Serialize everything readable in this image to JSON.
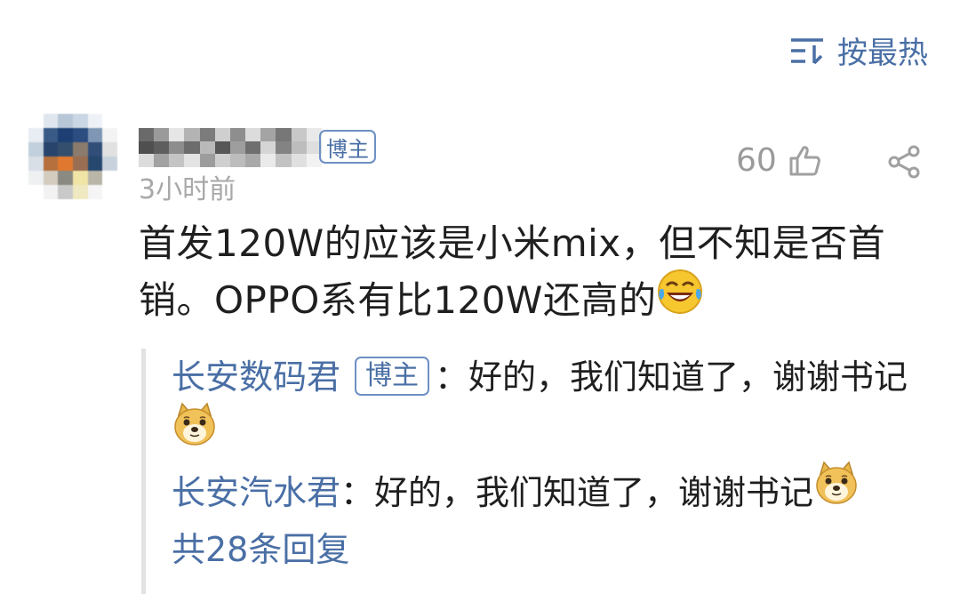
{
  "sort": {
    "icon": "sort-icon",
    "label": "按最热"
  },
  "comment": {
    "badge": "博主",
    "time": "3小时前",
    "likes": "60",
    "text_part1": "首发120W的应该是小米mix，但不知是否首销。OPPO系有比120W还高的",
    "emoji": "laughing-crying-emoji"
  },
  "replies": [
    {
      "name": "长安数码君",
      "badge": "博主",
      "text": "：好的，我们知道了，谢谢书记",
      "emoji": "doge-emoji"
    },
    {
      "name": "长安汽水君",
      "text": "：好的，我们知道了，谢谢书记",
      "emoji": "doge-emoji"
    }
  ],
  "reply_count": "共28条回复",
  "colors": {
    "accent": "#4a6fa5",
    "muted": "#a8a8a8"
  }
}
